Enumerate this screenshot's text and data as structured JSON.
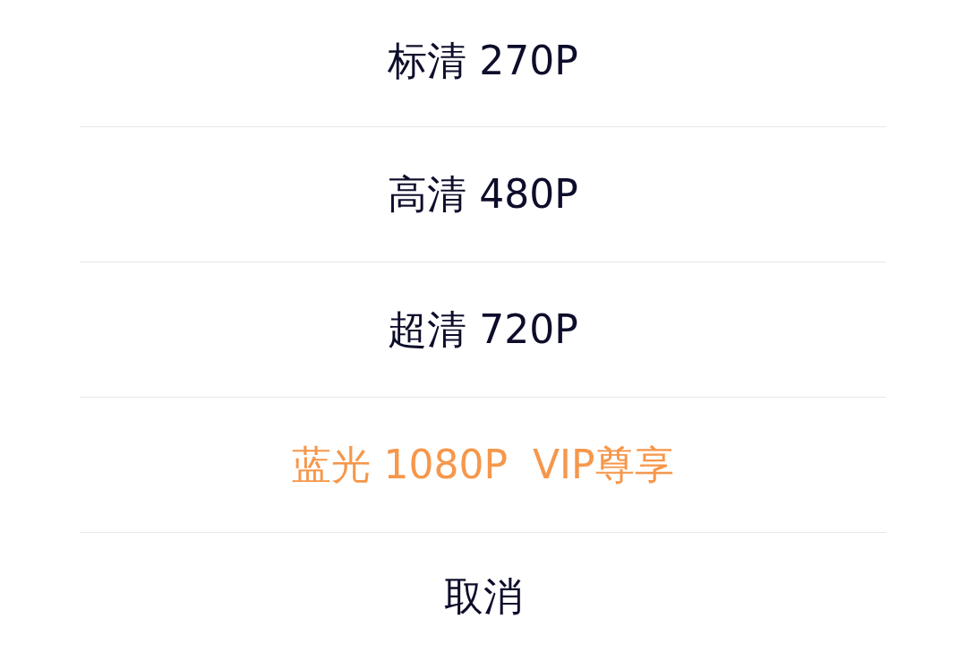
{
  "options": [
    {
      "label": "标清 270P",
      "kind": "normal"
    },
    {
      "label": "高清 480P",
      "kind": "normal"
    },
    {
      "label": "超清 720P",
      "kind": "normal"
    },
    {
      "label": "蓝光 1080P  VIP尊享",
      "kind": "vip"
    }
  ],
  "cancel": {
    "label": "取消"
  }
}
